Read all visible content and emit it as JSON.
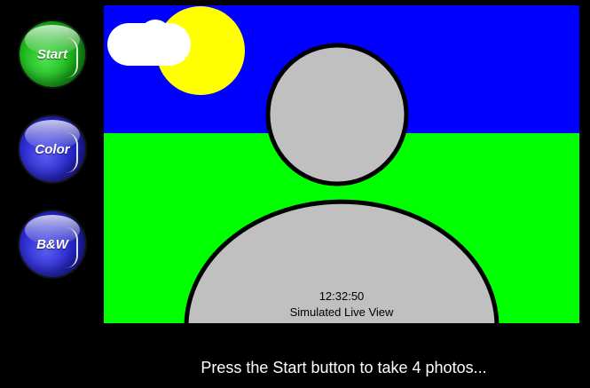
{
  "buttons": {
    "start_label": "Start",
    "color_label": "Color",
    "bw_label": "B&W"
  },
  "live_view": {
    "time": "12:32:50",
    "caption": "Simulated Live View"
  },
  "status": {
    "message": "Press the Start button to take 4 photos..."
  },
  "colors": {
    "sky": "#0000ff",
    "grass": "#00ff00",
    "sun": "#ffff00",
    "cloud": "#ffffff",
    "figure": "#c0c0c0",
    "start_button": "#1cb81c",
    "mode_buttons": "#2a2ad0"
  }
}
